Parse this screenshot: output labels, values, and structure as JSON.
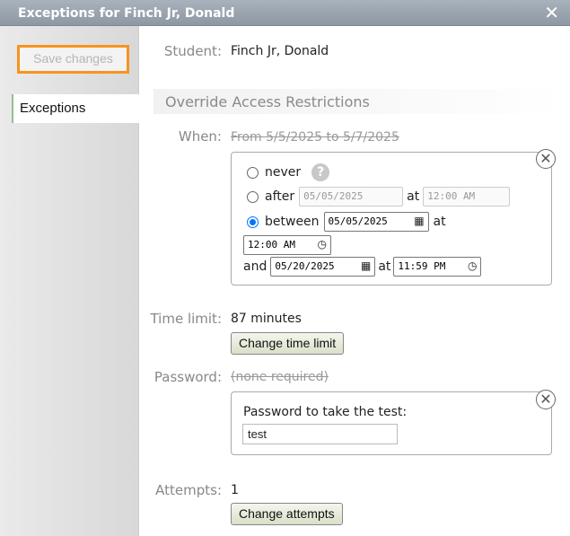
{
  "dialog": {
    "title": "Exceptions for Finch Jr, Donald",
    "close_glyph": "✕"
  },
  "sidebar": {
    "save_label": "Save changes",
    "tab_label": "Exceptions"
  },
  "student": {
    "label": "Student:",
    "value": "Finch Jr, Donald"
  },
  "section": {
    "title": "Override Access Restrictions"
  },
  "when": {
    "label": "When:",
    "current": "From 5/5/2025 to 5/7/2025",
    "never_label": "never",
    "after_label": "after",
    "after_date": "05/05/2025",
    "after_at": "at",
    "after_time": "12:00 AM",
    "between_label": "between",
    "between_start_date": "05/05/2025",
    "between_at": "at",
    "between_start_time": "12:00 AM",
    "and_label": "and",
    "between_end_date": "05/20/2025",
    "end_at": "at",
    "between_end_time": "11:59 PM",
    "help_glyph": "?"
  },
  "time_limit": {
    "label": "Time limit:",
    "value": "87 minutes",
    "button": "Change time limit"
  },
  "password": {
    "label": "Password:",
    "current": "(none required)",
    "prompt": "Password to take the test:",
    "value": "test"
  },
  "attempts": {
    "label": "Attempts:",
    "value": "1",
    "button": "Change attempts"
  },
  "icons": {
    "calendar": "calendar-icon",
    "clock": "clock-icon",
    "remove": "remove-circle-icon"
  }
}
